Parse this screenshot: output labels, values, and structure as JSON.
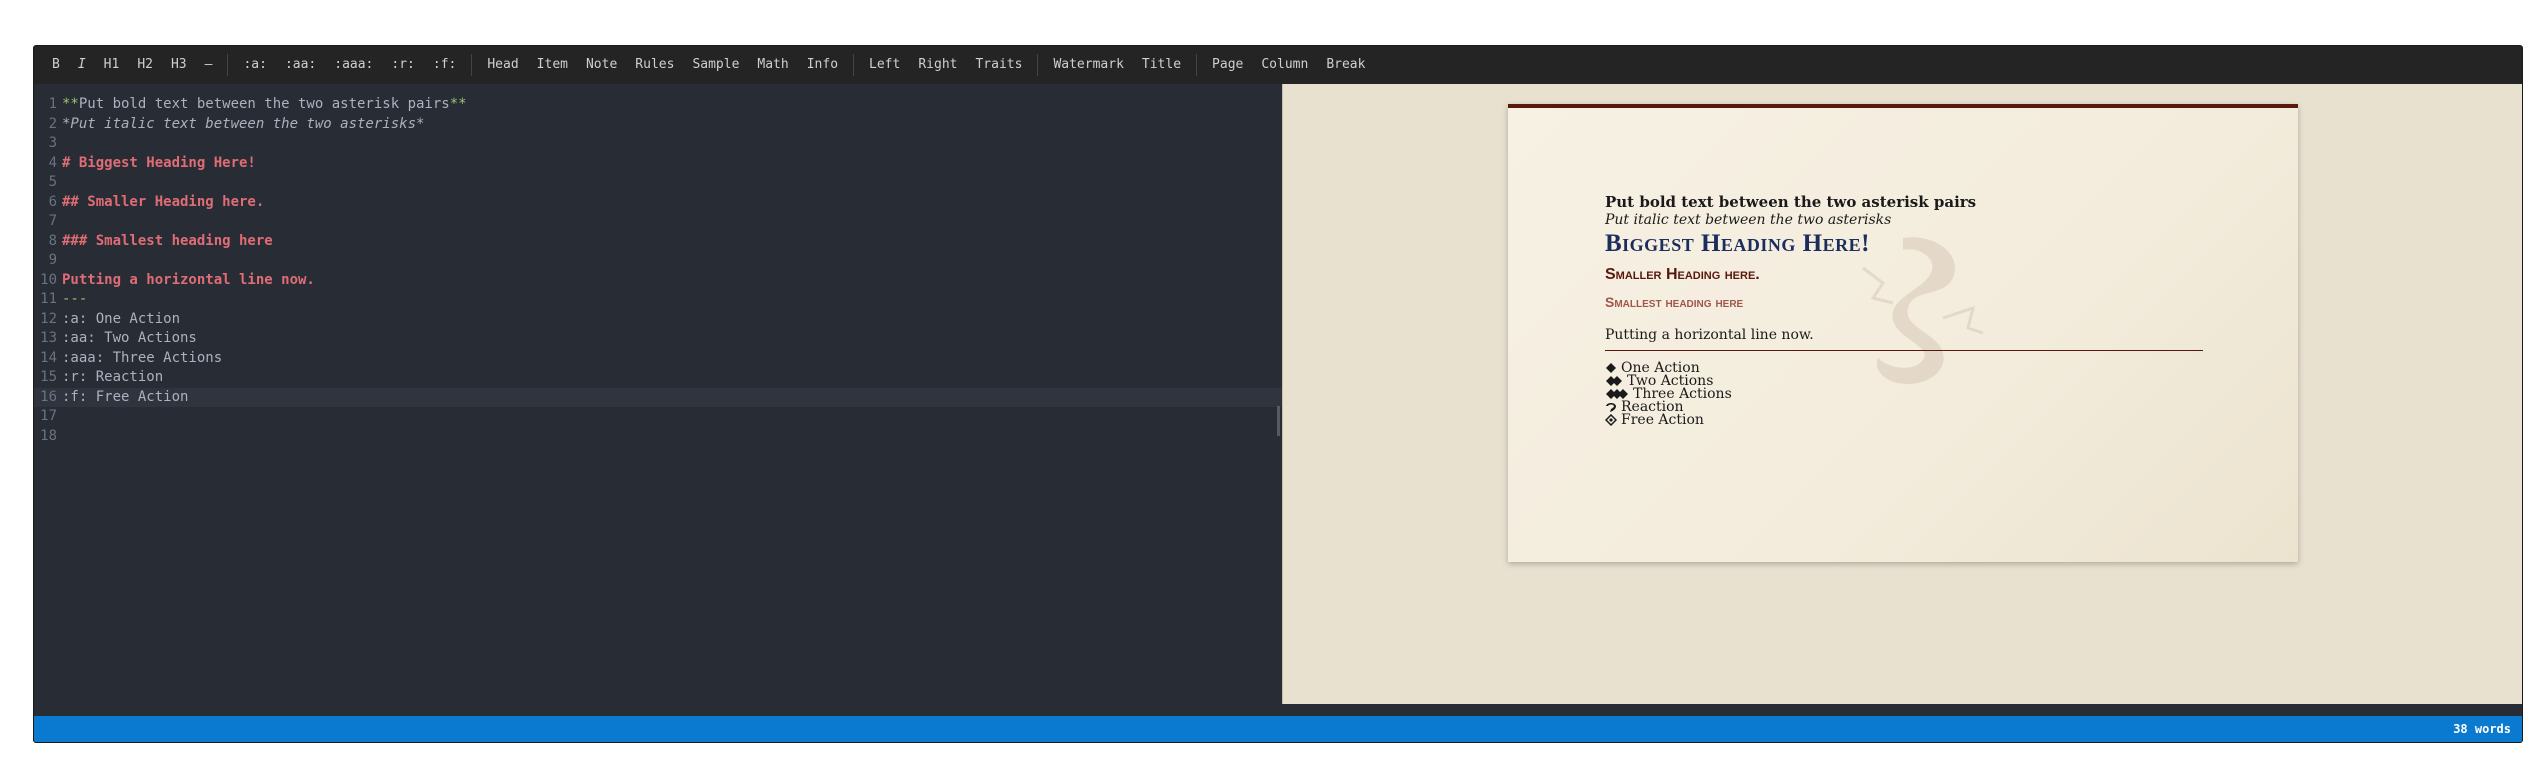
{
  "toolbar": {
    "groups": [
      [
        {
          "label": "B",
          "name": "bold-button"
        },
        {
          "label": "I",
          "name": "italic-button",
          "italic": true
        },
        {
          "label": "H1",
          "name": "h1-button"
        },
        {
          "label": "H2",
          "name": "h2-button"
        },
        {
          "label": "H3",
          "name": "h3-button"
        },
        {
          "label": "—",
          "name": "horizontal-rule-button"
        }
      ],
      [
        {
          "label": ":a:",
          "name": "one-action-button"
        },
        {
          "label": ":aa:",
          "name": "two-actions-button"
        },
        {
          "label": ":aaa:",
          "name": "three-actions-button"
        },
        {
          "label": ":r:",
          "name": "reaction-button"
        },
        {
          "label": ":f:",
          "name": "free-action-button"
        }
      ],
      [
        {
          "label": "Head",
          "name": "head-button"
        },
        {
          "label": "Item",
          "name": "item-button"
        },
        {
          "label": "Note",
          "name": "note-button"
        },
        {
          "label": "Rules",
          "name": "rules-button"
        },
        {
          "label": "Sample",
          "name": "sample-button"
        },
        {
          "label": "Math",
          "name": "math-button"
        },
        {
          "label": "Info",
          "name": "info-button"
        }
      ],
      [
        {
          "label": "Left",
          "name": "left-button"
        },
        {
          "label": "Right",
          "name": "right-button"
        },
        {
          "label": "Traits",
          "name": "traits-button"
        }
      ],
      [
        {
          "label": "Watermark",
          "name": "watermark-button"
        },
        {
          "label": "Title",
          "name": "title-button"
        }
      ],
      [
        {
          "label": "Page",
          "name": "page-button"
        },
        {
          "label": "Column",
          "name": "column-button"
        },
        {
          "label": "Break",
          "name": "break-button"
        }
      ]
    ]
  },
  "editor": {
    "active_line": 16,
    "lines": [
      {
        "n": "1",
        "tokens": [
          {
            "t": "**",
            "c": "green"
          },
          {
            "t": "Put bold text between the two asterisk pairs",
            "c": "plain"
          },
          {
            "t": "**",
            "c": "green"
          }
        ]
      },
      {
        "n": "2",
        "tokens": [
          {
            "t": "*Put italic text between the two asterisks*",
            "c": "italic"
          }
        ]
      },
      {
        "n": "3",
        "tokens": []
      },
      {
        "n": "4",
        "tokens": [
          {
            "t": "# Biggest Heading Here!",
            "c": "red"
          }
        ]
      },
      {
        "n": "5",
        "tokens": []
      },
      {
        "n": "6",
        "tokens": [
          {
            "t": "## Smaller Heading here.",
            "c": "red"
          }
        ]
      },
      {
        "n": "7",
        "tokens": []
      },
      {
        "n": "8",
        "tokens": [
          {
            "t": "### Smallest heading here",
            "c": "red"
          }
        ]
      },
      {
        "n": "9",
        "tokens": []
      },
      {
        "n": "10",
        "tokens": [
          {
            "t": "Putting a horizontal line now.",
            "c": "red"
          }
        ]
      },
      {
        "n": "11",
        "tokens": [
          {
            "t": "---",
            "c": "green"
          }
        ]
      },
      {
        "n": "12",
        "tokens": [
          {
            "t": ":a: One Action",
            "c": "plain"
          }
        ]
      },
      {
        "n": "13",
        "tokens": [
          {
            "t": ":aa: Two Actions",
            "c": "plain"
          }
        ]
      },
      {
        "n": "14",
        "tokens": [
          {
            "t": ":aaa: Three Actions",
            "c": "plain"
          }
        ]
      },
      {
        "n": "15",
        "tokens": [
          {
            "t": ":r: Reaction",
            "c": "plain"
          }
        ]
      },
      {
        "n": "16",
        "tokens": [
          {
            "t": ":f: Free Action",
            "c": "plain"
          }
        ]
      },
      {
        "n": "17",
        "tokens": []
      },
      {
        "n": "18",
        "tokens": []
      }
    ]
  },
  "preview": {
    "bold_text": "Put bold text between the two asterisk pairs",
    "italic_text": "Put italic text between the two asterisks",
    "h1": "Biggest Heading Here!",
    "h2": "Smaller Heading here.",
    "h3": "Smallest heading here",
    "paragraph": "Putting a horizontal line now.",
    "actions": [
      {
        "icon": "one-action-icon",
        "label": "One Action"
      },
      {
        "icon": "two-actions-icon",
        "label": "Two Actions"
      },
      {
        "icon": "three-actions-icon",
        "label": "Three Actions"
      },
      {
        "icon": "reaction-icon",
        "label": "Reaction"
      },
      {
        "icon": "free-action-icon",
        "label": "Free Action"
      }
    ]
  },
  "status": {
    "word_count": "38 words"
  },
  "colors": {
    "accent": "#0a7ad1",
    "heading1": "#1b2d5c",
    "heading2": "#58180d",
    "heading3": "#a0574a"
  }
}
